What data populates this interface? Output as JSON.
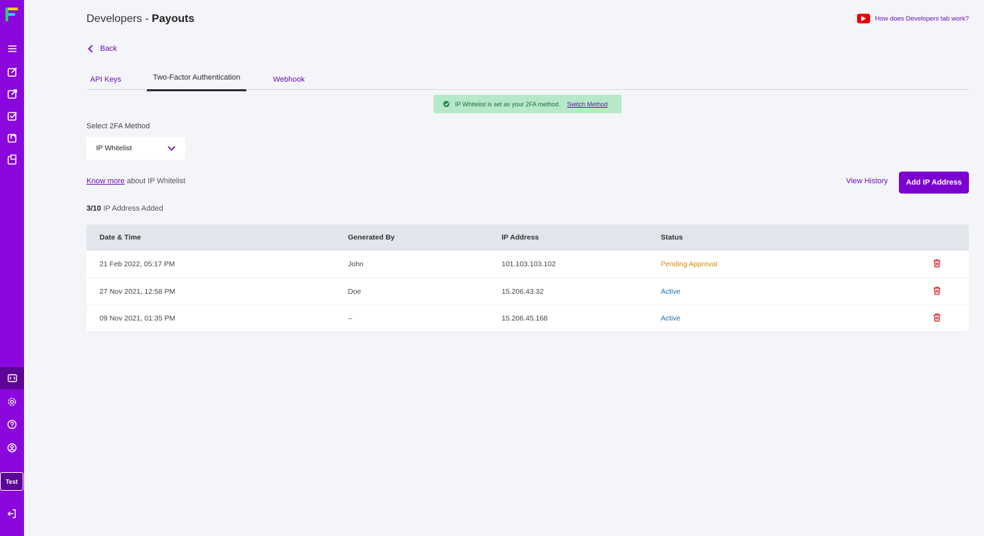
{
  "sidebar": {
    "logo": "payouts-logo",
    "items": [
      {
        "icon": "menu-icon"
      },
      {
        "icon": "edit-document-icon"
      },
      {
        "icon": "export-icon"
      },
      {
        "icon": "check-document-icon"
      },
      {
        "icon": "refresh-document-icon"
      },
      {
        "icon": "clipboard-icon"
      },
      {
        "icon": "developer-code-icon",
        "active": true
      },
      {
        "icon": "settings-icon"
      },
      {
        "icon": "help-icon"
      },
      {
        "icon": "profile-icon"
      },
      {
        "icon": "logout-icon"
      }
    ],
    "mode_badge": "Test"
  },
  "header": {
    "title_prefix": "Developers - ",
    "title_bold": "Payouts",
    "help_link": "How does Developers tab work?"
  },
  "back_label": "Back",
  "tabs": [
    {
      "label": "API Keys"
    },
    {
      "label": "Two-Factor Authentication",
      "active": true
    },
    {
      "label": "Webhook"
    }
  ],
  "notice": {
    "text": "IP Whitelist is set as your 2FA method.",
    "link": "Switch Method"
  },
  "method": {
    "label": "Select 2FA Method",
    "value": "IP Whitelist"
  },
  "info": {
    "link": "Know more",
    "text": " about IP Whitelist"
  },
  "actions": {
    "view_history": "View History",
    "add_ip": "Add IP Address"
  },
  "count": {
    "value": "3/10",
    "label": " IP Address Added"
  },
  "table": {
    "headers": [
      "Date & Time",
      "Generated By",
      "IP Address",
      "Status"
    ],
    "rows": [
      {
        "date": "21 Feb 2022, 05:17 PM",
        "by": "John",
        "ip": "101.103.103.102",
        "status": "Pending Approval"
      },
      {
        "date": "27 Nov 2021, 12:58 PM",
        "by": "Doe",
        "ip": "15.206.43.32",
        "status": "Active"
      },
      {
        "date": "09 Nov 2021, 01:35 PM",
        "by": "–",
        "ip": "15.206.45.168",
        "status": "Active"
      }
    ]
  },
  "colors": {
    "brand": "#8a08dd",
    "accent": "#6d0fb5",
    "pending": "#d38b00",
    "active": "#1a6fb3",
    "delete": "#d9252a",
    "success_bg": "#b6e9c9"
  }
}
